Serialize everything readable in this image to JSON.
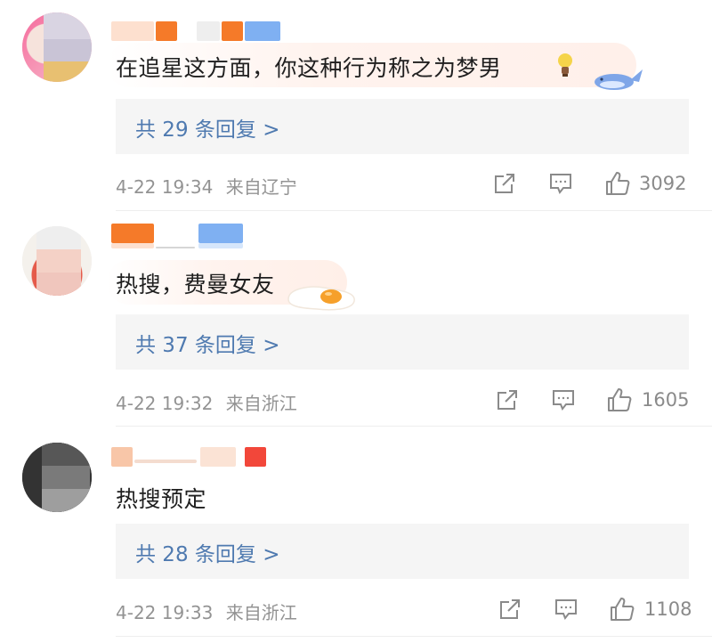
{
  "comments": [
    {
      "text": "在追星这方面，你这种行为称之为梦男",
      "replies": "共 29 条回复 >",
      "time": "4-22 19:34",
      "location": "来自辽宁",
      "likes": "3092"
    },
    {
      "text": "热搜，费曼女友",
      "replies": "共 37 条回复 >",
      "time": "4-22 19:32",
      "location": "来自浙江",
      "likes": "1605"
    },
    {
      "text": "热搜预定",
      "replies": "共 28 条回复 >",
      "time": "4-22 19:33",
      "location": "来自浙江",
      "likes": "1108"
    }
  ],
  "icons": {
    "share": "share-icon",
    "comment": "comment-icon",
    "like": "like-icon"
  },
  "colors": {
    "link": "#4f7ab0",
    "meta": "#939393",
    "reply_bg": "#f5f5f5"
  }
}
